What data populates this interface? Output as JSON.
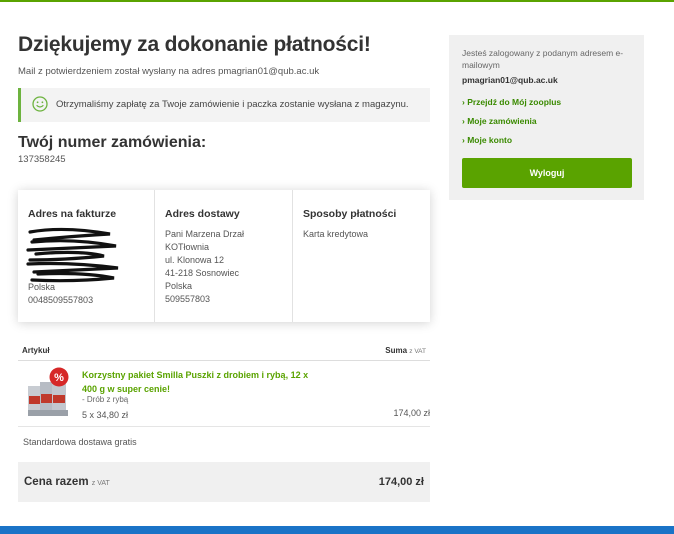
{
  "page": {
    "title": "Dziękujemy za dokonanie płatności!",
    "subtitle": "Mail z potwierdzeniem został wysłany na adres pmagrian01@qub.ac.uk",
    "notice": "Otrzymaliśmy zapłatę za Twoje zamówienie i paczka zostanie wysłana z magazynu.",
    "order_heading": "Twój numer zamówienia:",
    "order_number": "137358245"
  },
  "addresses": {
    "billing": {
      "heading": "Adres na fakturze",
      "country": "Polska",
      "phone": "0048509557803"
    },
    "shipping": {
      "heading": "Adres dostawy",
      "lines": [
        "Pani Marzena Drzał",
        "KOTłownia",
        "ul. Klonowa 12",
        "41-218 Sosnowiec",
        "Polska",
        "509557803"
      ]
    },
    "payment": {
      "heading": "Sposoby płatności",
      "method": "Karta kredytowa"
    }
  },
  "items_table": {
    "col_article": "Artykuł",
    "col_sum": "Suma",
    "col_sum_vat": "z VAT",
    "item": {
      "name": "Korzystny pakiet Smilla Puszki z drobiem i rybą, 12 x 400 g w super cenie!",
      "variant": "- Drób z rybą",
      "qty_price": "5 x 34,80 zł",
      "total": "174,00 zł",
      "badge": "%"
    }
  },
  "shipping_note": "Standardowa dostawa gratis",
  "summary": {
    "label": "Cena razem",
    "vat": "z VAT",
    "total": "174,00 zł"
  },
  "sidebar": {
    "logged_in_text": "Jesteś zalogowany z podanym adresem e-mailowym",
    "email": "pmagrian01@qub.ac.uk",
    "links": [
      "› Przejdź do Mój zooplus",
      "› Moje zamówienia",
      "› Moje konto"
    ],
    "logout_label": "Wyloguj"
  },
  "colors": {
    "accent_green": "#5aa300",
    "link_green": "#3a8a00",
    "bottom_bar_blue": "#1a73c7"
  },
  "icons": [
    "smiley-icon",
    "percent-badge-icon"
  ]
}
